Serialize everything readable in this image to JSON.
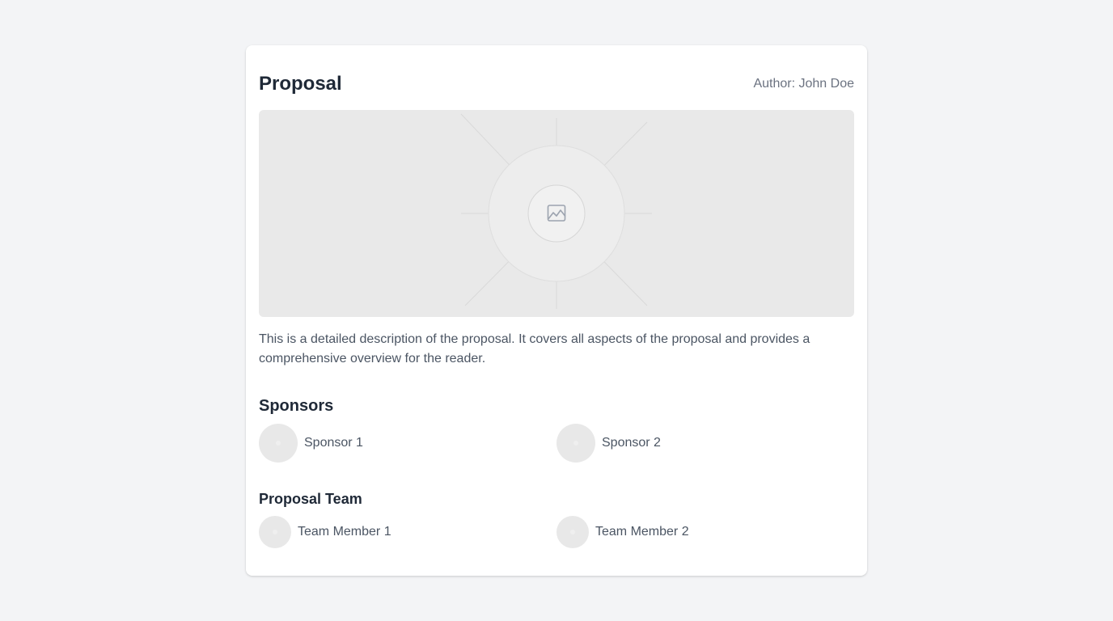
{
  "proposal": {
    "title": "Proposal",
    "author": "Author: John Doe",
    "image_icon": "image-placeholder-icon",
    "description": "This is a detailed description of the proposal. It covers all aspects of the proposal and provides a comprehensive overview for the reader."
  },
  "sponsors": {
    "heading": "Sponsors",
    "items": [
      {
        "name": "Sponsor 1",
        "icon": "avatar-placeholder"
      },
      {
        "name": "Sponsor 2",
        "icon": "avatar-placeholder"
      }
    ]
  },
  "team": {
    "heading": "Proposal Team",
    "items": [
      {
        "name": "Team Member 1",
        "icon": "avatar-placeholder"
      },
      {
        "name": "Team Member 2",
        "icon": "avatar-placeholder"
      }
    ]
  },
  "colors": {
    "page_background": "#f3f4f6",
    "card_background": "#ffffff",
    "heading_text": "#1f2937",
    "body_text": "#4b5563",
    "muted_text": "#6b7280",
    "placeholder_gray": "#e9e9e9"
  }
}
